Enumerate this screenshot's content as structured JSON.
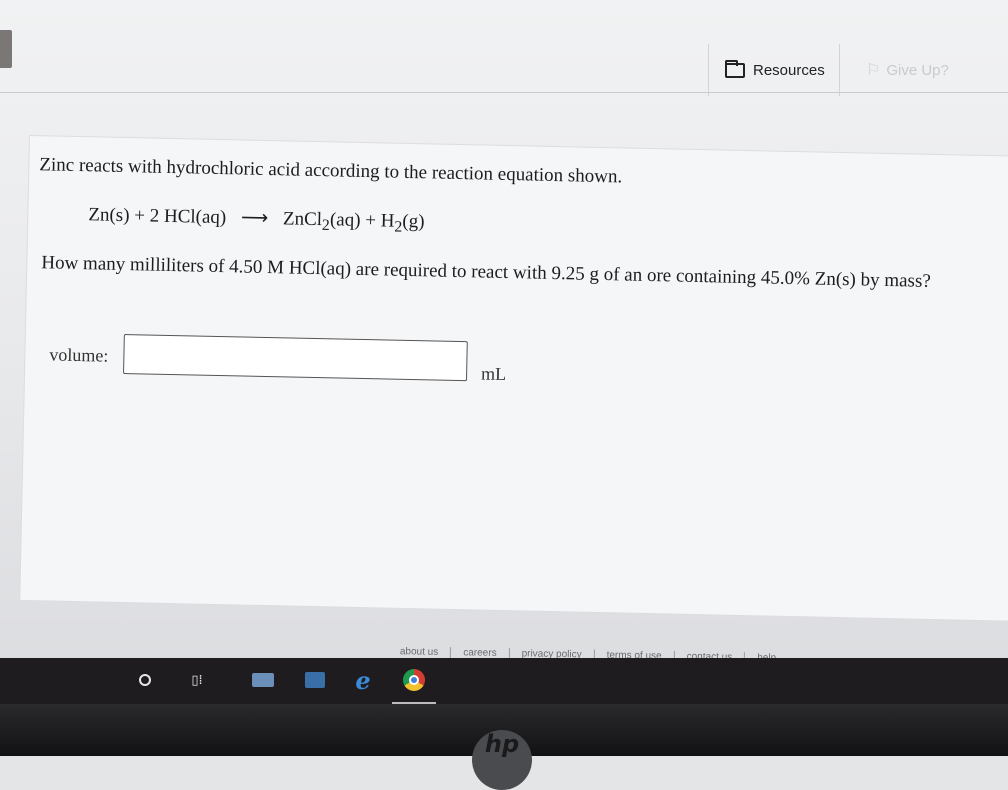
{
  "header": {
    "resources_label": "Resources",
    "give_up_label": "Give Up?"
  },
  "question": {
    "prompt": "Zinc reacts with hydrochloric acid according to the reaction equation shown.",
    "equation": {
      "reactant_1": "Zn(s)",
      "plus_1": "+",
      "reactant_2": "2 HCl(aq)",
      "arrow": "⟶",
      "product_1_main": "ZnCl",
      "product_1_sub": "2",
      "product_1_tail": "(aq)",
      "plus_2": "+",
      "product_2_main": "H",
      "product_2_sub": "2",
      "product_2_tail": "(g)"
    },
    "text": "How many milliliters of 4.50 M HCl(aq) are required to react with 9.25 g of an ore containing 45.0% Zn(s) by mass?",
    "answer_label": "volume:",
    "answer_value": "",
    "answer_unit": "mL"
  },
  "footer": {
    "links": [
      "about us",
      "careers",
      "privacy policy",
      "terms of use",
      "contact us",
      "help"
    ]
  },
  "taskbar": {
    "items": [
      "search-icon",
      "task-view-icon",
      "mail-icon",
      "store-icon",
      "edge-icon",
      "chrome-icon"
    ]
  },
  "device": {
    "brand": "hp"
  }
}
